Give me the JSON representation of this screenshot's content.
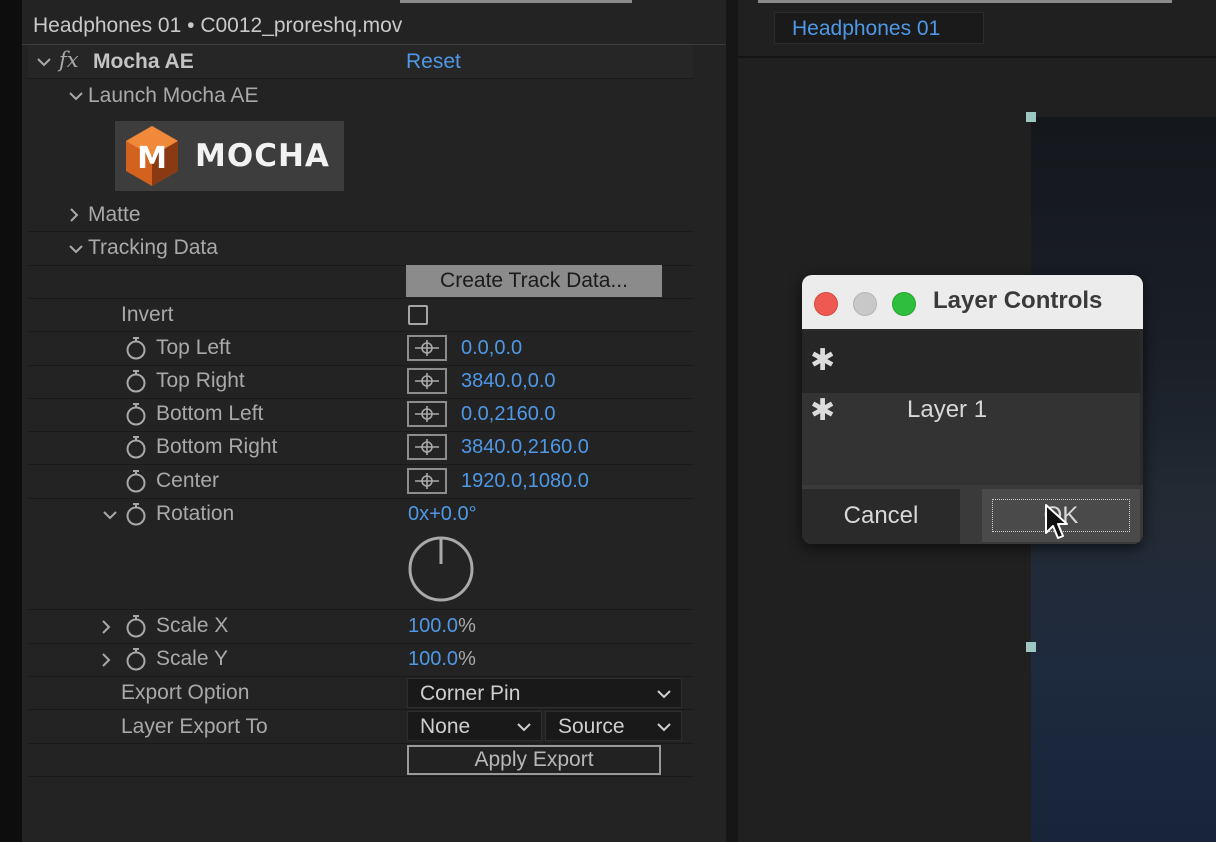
{
  "panel": {
    "title": "Headphones 01 • C0012_proreshq.mov",
    "effect_fx": "fx",
    "effect_name": "Mocha AE",
    "reset": "Reset",
    "launch_label": "Launch Mocha AE",
    "logo_text": "MOCHA",
    "matte_label": "Matte",
    "tracking_label": "Tracking Data",
    "create_track_data": "Create Track Data...",
    "invert_label": "Invert",
    "invert_checked": false,
    "pins": [
      {
        "label": "Top Left",
        "value": "0.0,0.0"
      },
      {
        "label": "Top Right",
        "value": "3840.0,0.0"
      },
      {
        "label": "Bottom Left",
        "value": "0.0,2160.0"
      },
      {
        "label": "Bottom Right",
        "value": "3840.0,2160.0"
      },
      {
        "label": "Center",
        "value": "1920.0,1080.0"
      }
    ],
    "rotation": {
      "label": "Rotation",
      "turns": "0x",
      "degrees": "+0.0°"
    },
    "scale_x": {
      "label": "Scale X",
      "value": "100.0",
      "unit": "%"
    },
    "scale_y": {
      "label": "Scale Y",
      "value": "100.0",
      "unit": "%"
    },
    "export_option": {
      "label": "Export Option",
      "value": "Corner Pin"
    },
    "layer_export": {
      "label": "Layer Export To",
      "layer": "None",
      "source": "Source"
    },
    "apply_export": "Apply Export"
  },
  "viewer": {
    "tab": "Headphones 01"
  },
  "dialog": {
    "title": "Layer Controls",
    "layer_name": "Layer 1",
    "cancel": "Cancel",
    "ok": "OK"
  },
  "colors": {
    "accent": "#4e98e6",
    "traffic_red": "#ee5a52",
    "traffic_gray": "#c8c8c8",
    "traffic_green": "#2fbf3d"
  }
}
